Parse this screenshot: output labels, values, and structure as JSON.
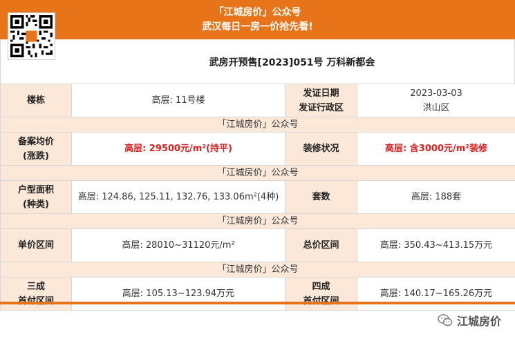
{
  "header": {
    "line1": "「江城房价」公众号",
    "line2": "武汉每日一房一价抢先看!"
  },
  "qr": {
    "label": "江城房价"
  },
  "title": "武房开预售[2023]051号 万科新都会",
  "separator": "「江城房价」公众号",
  "rows": {
    "r1": {
      "label": "楼栋",
      "value": "高层: 11号楼",
      "label2_a": "发证日期",
      "label2_b": "发证行政区",
      "value2_a": "2023-03-03",
      "value2_b": "洪山区"
    },
    "r2": {
      "label_a": "备案均价",
      "label_b": "(涨跌)",
      "value": "高层: 29500元/m²(持平)",
      "label2": "装修状况",
      "value2": "高层: 含3000元/m²装修"
    },
    "r3": {
      "label_a": "户型面积",
      "label_b": "(种类)",
      "value": "高层: 124.86, 125.11, 132.76, 133.06m²(4种)",
      "label2": "套数",
      "value2": "高层: 188套"
    },
    "r4": {
      "label": "单价区间",
      "value": "高层: 28010~31120元/m²",
      "label2": "总价区间",
      "value2": "高层: 350.43~413.15万元"
    },
    "r5": {
      "label_a": "三成",
      "label_b": "首付区间",
      "value": "高层: 105.13~123.94万元",
      "label2_a": "四成",
      "label2_b": "首付区间",
      "value2": "高层: 140.17~165.26万元"
    }
  },
  "watermark": {
    "text": "江城房价",
    "icon": "wechat-icon"
  },
  "colors": {
    "accent": "#e8741a",
    "label_bg": "#fbe8d9",
    "highlight": "#d62121"
  }
}
